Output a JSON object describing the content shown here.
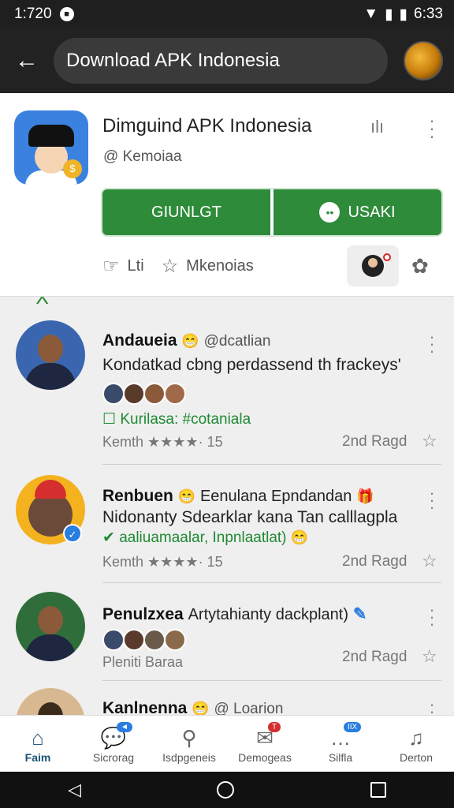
{
  "status_bar": {
    "time": "1:720",
    "clock": "6:33",
    "icons": [
      "lock-icon",
      "wifi-icon",
      "signal-icon",
      "battery-icon"
    ]
  },
  "app_bar": {
    "search_text": "Download APK Indonesia"
  },
  "app_card": {
    "title": "Dimguind APK Indonesia",
    "developer": "@ Kemoiaa",
    "primary_button": "GIUNLGT",
    "secondary_button": "USAKI",
    "actions": [
      {
        "label": "Lti",
        "icon": "thumbs-up-icon"
      },
      {
        "label": "Mkenoias",
        "icon": "star-icon"
      }
    ]
  },
  "posts": [
    {
      "name": "Andaueia",
      "handle": "@dcatlian",
      "body": "Kondatkad cbng perdassend th frackeys'",
      "link": "Kurilasa: #cotaniala",
      "meta": "Kemth ★★★★· 15",
      "rank": "2nd Ragd"
    },
    {
      "name": "Renbuen",
      "extra": "Eenulana Epndandan",
      "body": "Nidonanty Sdearklar kana Tan calllagpla",
      "link": "aaliuamaalar, Inpnlaatlat)",
      "meta": "Kemth ★★★★· 15",
      "rank": "2nd Ragd"
    },
    {
      "name": "Penulzxea",
      "extra": "Artytahianty dackplant)",
      "meta": "Pleniti Baraa",
      "rank": "2nd Ragd"
    },
    {
      "name": "Kanlnenna",
      "handle": "@ Loarion"
    }
  ],
  "bottom_nav": [
    {
      "label": "Faim",
      "icon": "home-icon",
      "active": true
    },
    {
      "label": "Sicrorag",
      "icon": "chat-bubble-icon",
      "active": false
    },
    {
      "label": "Isdpgeneis",
      "icon": "search-icon",
      "active": false
    },
    {
      "label": "Demogeas",
      "icon": "inbox-icon",
      "active": false,
      "badge": "T"
    },
    {
      "label": "Silfla",
      "icon": "chat-dots-icon",
      "active": false,
      "badge": "IIX"
    },
    {
      "label": "Derton",
      "icon": "bell-icon",
      "active": false
    }
  ],
  "colors": {
    "accent": "#2e8b3a",
    "app_bar": "#222222",
    "link": "#1f8a33"
  }
}
